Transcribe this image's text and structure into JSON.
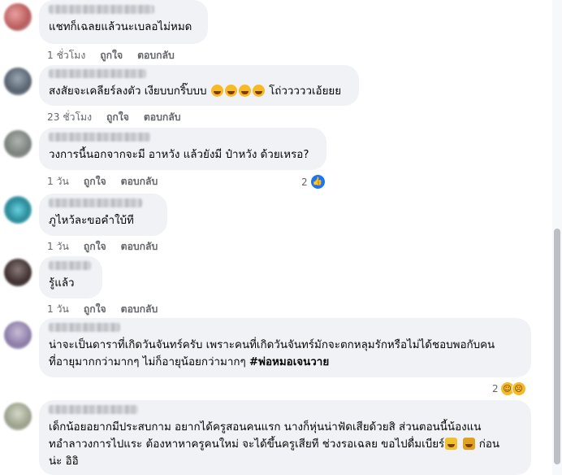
{
  "comments": [
    {
      "text": "แชทก็เฉลยแล้วนะเบลอไม่หมด",
      "time": "1 ชั่วโมง",
      "like_label": "ถูกใจ",
      "reply_label": "ตอบกลับ",
      "reaction_count": "",
      "avatar_color": "#b85a5a"
    },
    {
      "text": "สงสัยจะเคลียร์ลงตัว เงียบบกริ๊บบบ",
      "text_suffix": "โถ่วววววเอ้ยยย",
      "emoji_names": [
        "rolling-on-floor-laughing",
        "rolling-on-floor-laughing",
        "rolling-on-floor-laughing",
        "rolling-on-floor-laughing"
      ],
      "time": "23 ชั่วโมง",
      "like_label": "ถูกใจ",
      "reply_label": "ตอบกลับ",
      "avatar_color": "#6c7a86"
    },
    {
      "text": "วงการนี้นอกจากจะมี อาหวัง แล้วยังมี ป๋าหวัง ด้วยเหรอ?",
      "time": "1 วัน",
      "like_label": "ถูกใจ",
      "reply_label": "ตอบกลับ",
      "reaction_count": "2",
      "reaction_icons": [
        "like-icon"
      ],
      "avatar_color": "#8a8f8c"
    },
    {
      "text": "ภูไหว้ละขอคำใบ้ที",
      "time": "1 วัน",
      "like_label": "ถูกใจ",
      "reply_label": "ตอบกลับ",
      "avatar_color": "#3aa7b5"
    },
    {
      "text": "รู้แล้ว",
      "time": "1 วัน",
      "like_label": "ถูกใจ",
      "reply_label": "ตอบกลับ",
      "avatar_color": "#5a4a4a"
    },
    {
      "text_line1": "น่าจะเป็นดาราที่เกิดวันจันทร์ครับ เพราะคนที่เกิดวันจันทร์มักจะตกหลุมรักหรือไม่ได้ชอบพอกับคน",
      "text_line2": "ที่อายุมากกว่ามากๆ ไม่ก็อายุน้อยกว่ามากๆ",
      "hashtag": "#พ่อหมอเจนวาย",
      "reaction_count": "2",
      "reaction_icons": [
        "grinning-sweat-icon",
        "sad-icon"
      ],
      "avatar_color": "#9a8fb0"
    },
    {
      "text_line1": "เด็กน้อยอยากมีประสบกาม อยากได้ครูสอนคนแรก นางก็หุ่นน่าฟัดเสียด้วยสิ ส่วนตอนนี้น้องแน",
      "text_line2": "ทอำลาวงการไปแระ ต้องหาหาครูคนใหม่ จะได้ขึ้นครูเสียที ช่วงรอเฉลย ขอไปดื่มเบียร์",
      "text_line2_suffix": "ก่อน",
      "text_line3": "น่ะ อิอิ",
      "emoji_names": [
        "crown-icon",
        "beer-icon"
      ],
      "avatar_color": "#a8b0a0"
    }
  ]
}
